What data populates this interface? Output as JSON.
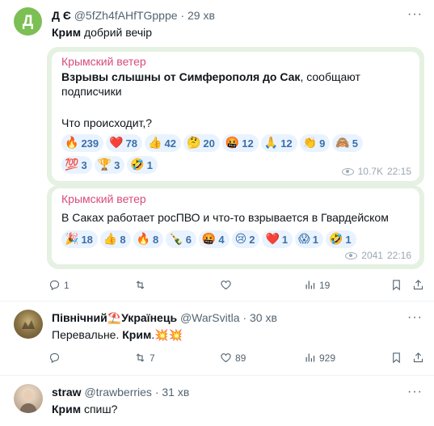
{
  "post1": {
    "avatar_letter": "Д",
    "name": "Д Є",
    "handle": "@5fZh4fAHfTGpppe",
    "dot": "·",
    "time": "29 хв",
    "text_bold": "Крим",
    "text_rest": " добрий вечір",
    "more": "···",
    "card1": {
      "channel": "Крымский ветер",
      "headline_bold": "Взрывы слышны от Симферополя до Сак",
      "headline_rest": ", сообщают",
      "line2": "подписчики",
      "line3": "Что происходит,?",
      "reactions_row1": [
        {
          "emoji": "🔥",
          "count": "239"
        },
        {
          "emoji": "❤️",
          "count": "78"
        },
        {
          "emoji": "👍",
          "count": "42"
        },
        {
          "emoji": "🤔",
          "count": "20"
        },
        {
          "emoji": "🤬",
          "count": "12"
        },
        {
          "emoji": "🙏",
          "count": "12"
        },
        {
          "emoji": "👏",
          "count": "9"
        },
        {
          "emoji": "🙈",
          "count": "5"
        }
      ],
      "reactions_row2": [
        {
          "emoji": "💯",
          "count": "3"
        },
        {
          "emoji": "🏆",
          "count": "3"
        },
        {
          "emoji": "🤣",
          "count": "1"
        }
      ],
      "views": "10.7K",
      "time": "22:15"
    },
    "card2": {
      "channel": "Крымский ветер",
      "text": "В Саках работает росПВО и что-то взрывается в Гвардейском",
      "reactions": [
        {
          "emoji": "🎉",
          "count": "18"
        },
        {
          "emoji": "👍",
          "count": "8"
        },
        {
          "emoji": "🔥",
          "count": "8"
        },
        {
          "emoji": "🍾",
          "count": "6"
        },
        {
          "emoji": "🤬",
          "count": "4"
        },
        {
          "emoji": "😢",
          "count": "2"
        },
        {
          "emoji": "❤️",
          "count": "1"
        },
        {
          "emoji": "😱",
          "count": "1"
        },
        {
          "emoji": "🤣",
          "count": "1"
        }
      ],
      "views": "2041",
      "time": "22:16"
    },
    "replies": "1",
    "retweets": "",
    "likes": "",
    "views": "19"
  },
  "post2": {
    "name": "Північний⛱️Українець",
    "handle": "@WarSvitla",
    "dot": "·",
    "time": "30 хв",
    "text_pre": "Перевальне. ",
    "text_bold": "Крим",
    "text_post": ".💥💥",
    "replies": "",
    "retweets": "7",
    "likes": "89",
    "views": "929"
  },
  "post3": {
    "name": "straw",
    "handle": "@trawberries",
    "dot": "·",
    "time": "31 хв",
    "text_bold": "Крим",
    "text_rest": " спиш?"
  },
  "colors": {
    "channel_pink": "#d64b7b",
    "reaction_blue": "#3b6fa8",
    "card_green": "#e5f1e2",
    "avatar_green": "#7cbf55"
  }
}
